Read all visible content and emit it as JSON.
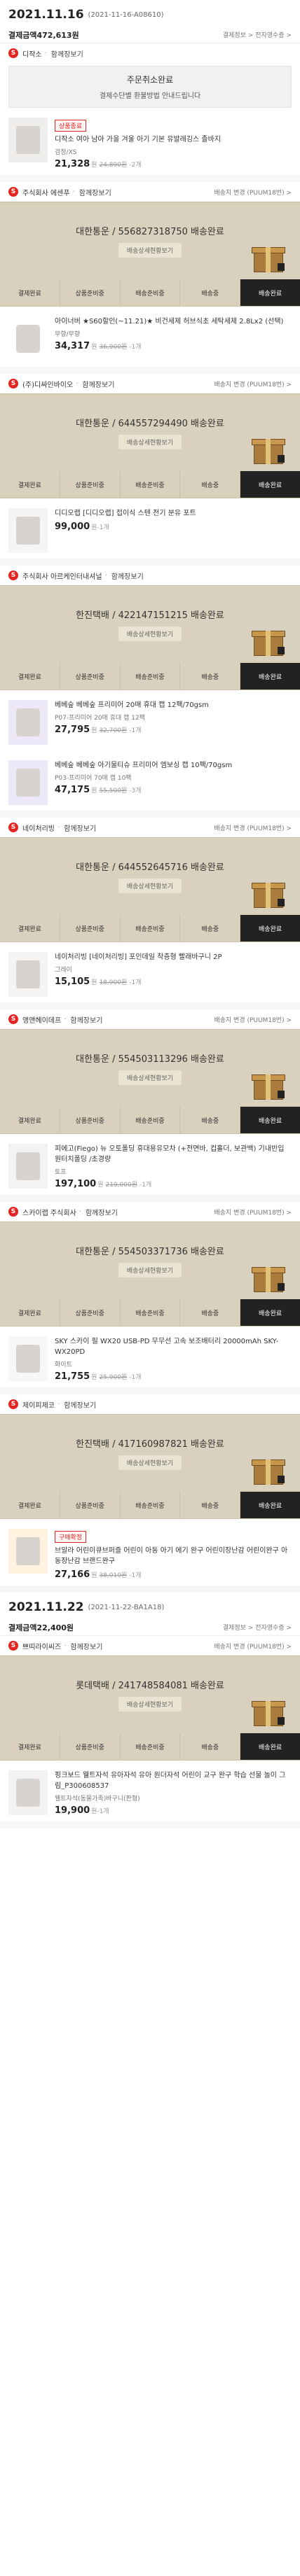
{
  "orders": [
    {
      "date": "2021.11.16",
      "order_no": "(2021-11-16-A08610)",
      "total_label": "결제금액",
      "total": "472,613원",
      "links": "결제정보 > 전자영수증 >",
      "groups": [
        {
          "shop": "디작소",
          "sub": "함께장보기",
          "extra": "",
          "cancelled": true,
          "cancel_title": "주문취소완료",
          "cancel_note": "결제수단별 환불방법 안내드립니다",
          "products": [
            {
              "tag": "상품종료",
              "name": "디작소 여아 남아 가을 겨울 아기 기본 유발레깅스 졸바지",
              "option": "검정/XS",
              "price": "21,328",
              "orig": "24,890원",
              "qty": "2개"
            }
          ]
        },
        {
          "shop": "주식회사 에센푸",
          "sub": "함께장보기",
          "extra": "배송지 변경 (PUUM18번) >",
          "tracking": "대한통운 / 556827318750 배송완료",
          "detail_btn": "배송상세현황보기",
          "steps": [
            "결제완료",
            "상품준비중",
            "배송준비중",
            "배송중",
            "배송완료"
          ],
          "products": [
            {
              "name": "아이너버 ★S60할인(~11.21)★ 비건세제 허브식초 세탁세제 2.8Lx2 (선택)",
              "option": "무향/무향",
              "price": "34,317",
              "orig": "36,900원",
              "qty": "1개"
            }
          ]
        },
        {
          "shop": "(주)디싸인바이오",
          "sub": "함께장보기",
          "extra": "배송지 변경 (PUUM18번) >",
          "tracking": "대한통운 / 644557294490 배송완료",
          "detail_btn": "배송상세현황보기",
          "steps": [
            "결제완료",
            "상품준비중",
            "배송준비중",
            "배송중",
            "배송완료"
          ],
          "products": [
            {
              "name": "디디오랩 [디디오랩] 접이식 스텐 전기 분유 포트",
              "option": "",
              "price": "99,000",
              "orig": "",
              "qty": "1개"
            }
          ]
        },
        {
          "shop": "주식회사 아르케인터내셔널",
          "sub": "함께장보기",
          "extra": "",
          "tracking": "한진택배 / 422147151215 배송완료",
          "detail_btn": "배송상세현황보기",
          "steps": [
            "결제완료",
            "상품준비중",
            "배송준비중",
            "배송중",
            "배송완료"
          ],
          "products": [
            {
              "name": "베베숲 베베숲 프리미어 20매 휴대 캡 12팩/70gsm",
              "option": "P07-프리미어 20매 휴대 캡 12팩",
              "price": "27,795",
              "orig": "32,700원",
              "qty": "1개"
            },
            {
              "name": "베베숲 베베숲 아기물티슈 프리미어 엠보싱 캡 10팩/70gsm",
              "option": "P03-프리미어 70매 캡 10팩",
              "price": "47,175",
              "orig": "55,500원",
              "qty": "3개"
            }
          ]
        },
        {
          "shop": "네이처리빙",
          "sub": "함께장보기",
          "extra": "배송지 변경 (PUUM18번) >",
          "tracking": "대한통운 / 644552645716 배송완료",
          "detail_btn": "배송상세현황보기",
          "steps": [
            "결제완료",
            "상품준비중",
            "배송준비중",
            "배송중",
            "배송완료"
          ],
          "products": [
            {
              "name": "네이처리빙 [네이처리빙] 포인데일 착층형 빨래바구니 2P",
              "option": "그레이",
              "price": "15,105",
              "orig": "18,900원",
              "qty": "1개"
            }
          ]
        },
        {
          "shop": "앵앤헤이데프",
          "sub": "함께장보기",
          "extra": "배송지 변경 (PUUM18번) >",
          "tracking": "대한통운 / 554503113296 배송완료",
          "detail_btn": "배송상세현황보기",
          "steps": [
            "결제완료",
            "상품준비중",
            "배송준비중",
            "배송중",
            "배송완료"
          ],
          "products": [
            {
              "name": "피에고(Fiego) 뉴 오토폴딩 휴대용유모차 (+전면바, 컵홀더, 보관백) 기내반입 원터치폴딩 /초경량",
              "option": "토프",
              "price": "197,100",
              "orig": "219,000원",
              "qty": "1개"
            }
          ]
        },
        {
          "shop": "스카이랩 주식회사",
          "sub": "함께장보기",
          "extra": "배송지 변경 (PUUM18번) >",
          "tracking": "대한통운 / 554503371736 배송완료",
          "detail_btn": "배송상세현황보기",
          "steps": [
            "결제완료",
            "상품준비중",
            "배송준비중",
            "배송중",
            "배송완료"
          ],
          "products": [
            {
              "name": "SKY 스카이 필 WX20 USB-PD 무무선 고속 보조배터리 20000mAh SKY-WX20PD",
              "option": "화이트",
              "price": "21,755",
              "orig": "25,900원",
              "qty": "1개"
            }
          ]
        },
        {
          "shop": "제이피제코",
          "sub": "함께장보기",
          "extra": "",
          "tracking": "한진택배 / 417160987821 배송완료",
          "detail_btn": "배송상세현황보기",
          "steps": [
            "결제완료",
            "상품준비중",
            "배송준비중",
            "배송중",
            "배송완료"
          ],
          "products": [
            {
              "tag": "구매확정",
              "name": "브알라 어린이큐브퍼즐 어린이 아동 아기 에기 완구 어린이장난감 어린이완구 아동장난감 브랜드완구",
              "option": "",
              "price": "27,166",
              "orig": "38,010원",
              "qty": "1개"
            }
          ]
        }
      ]
    },
    {
      "date": "2021.11.22",
      "order_no": "(2021-11-22-BA1A18)",
      "total_label": "결제금액",
      "total": "22,400원",
      "links": "결제정보 > 전자영수증 >",
      "groups": [
        {
          "shop": "쁘띠라이씨즈",
          "sub": "함께장보기",
          "extra": "배송지 변경 (PUUM18번) >",
          "tracking": "롯데택배 / 241748584081 배송완료",
          "detail_btn": "배송상세현황보기",
          "steps": [
            "결제완료",
            "상품준비중",
            "배송준비중",
            "배송중",
            "배송완료"
          ],
          "products": [
            {
              "name": "핑크보드 웰트자석 유아자석 유아 원더자석 어린이 교구 완구 학습 선물 놀이 그림_P300608537",
              "option": "웰트자석(동물가족)바구니(판형)",
              "price": "19,900",
              "orig": "",
              "qty": "1개"
            }
          ]
        }
      ]
    }
  ],
  "labels": {
    "shop_icon": "S",
    "qty_prefix": "-",
    "won": "원"
  },
  "colors": {
    "brand": "#e52521",
    "delivery_bg": "#d9d1bd",
    "active_step": "#222222"
  }
}
